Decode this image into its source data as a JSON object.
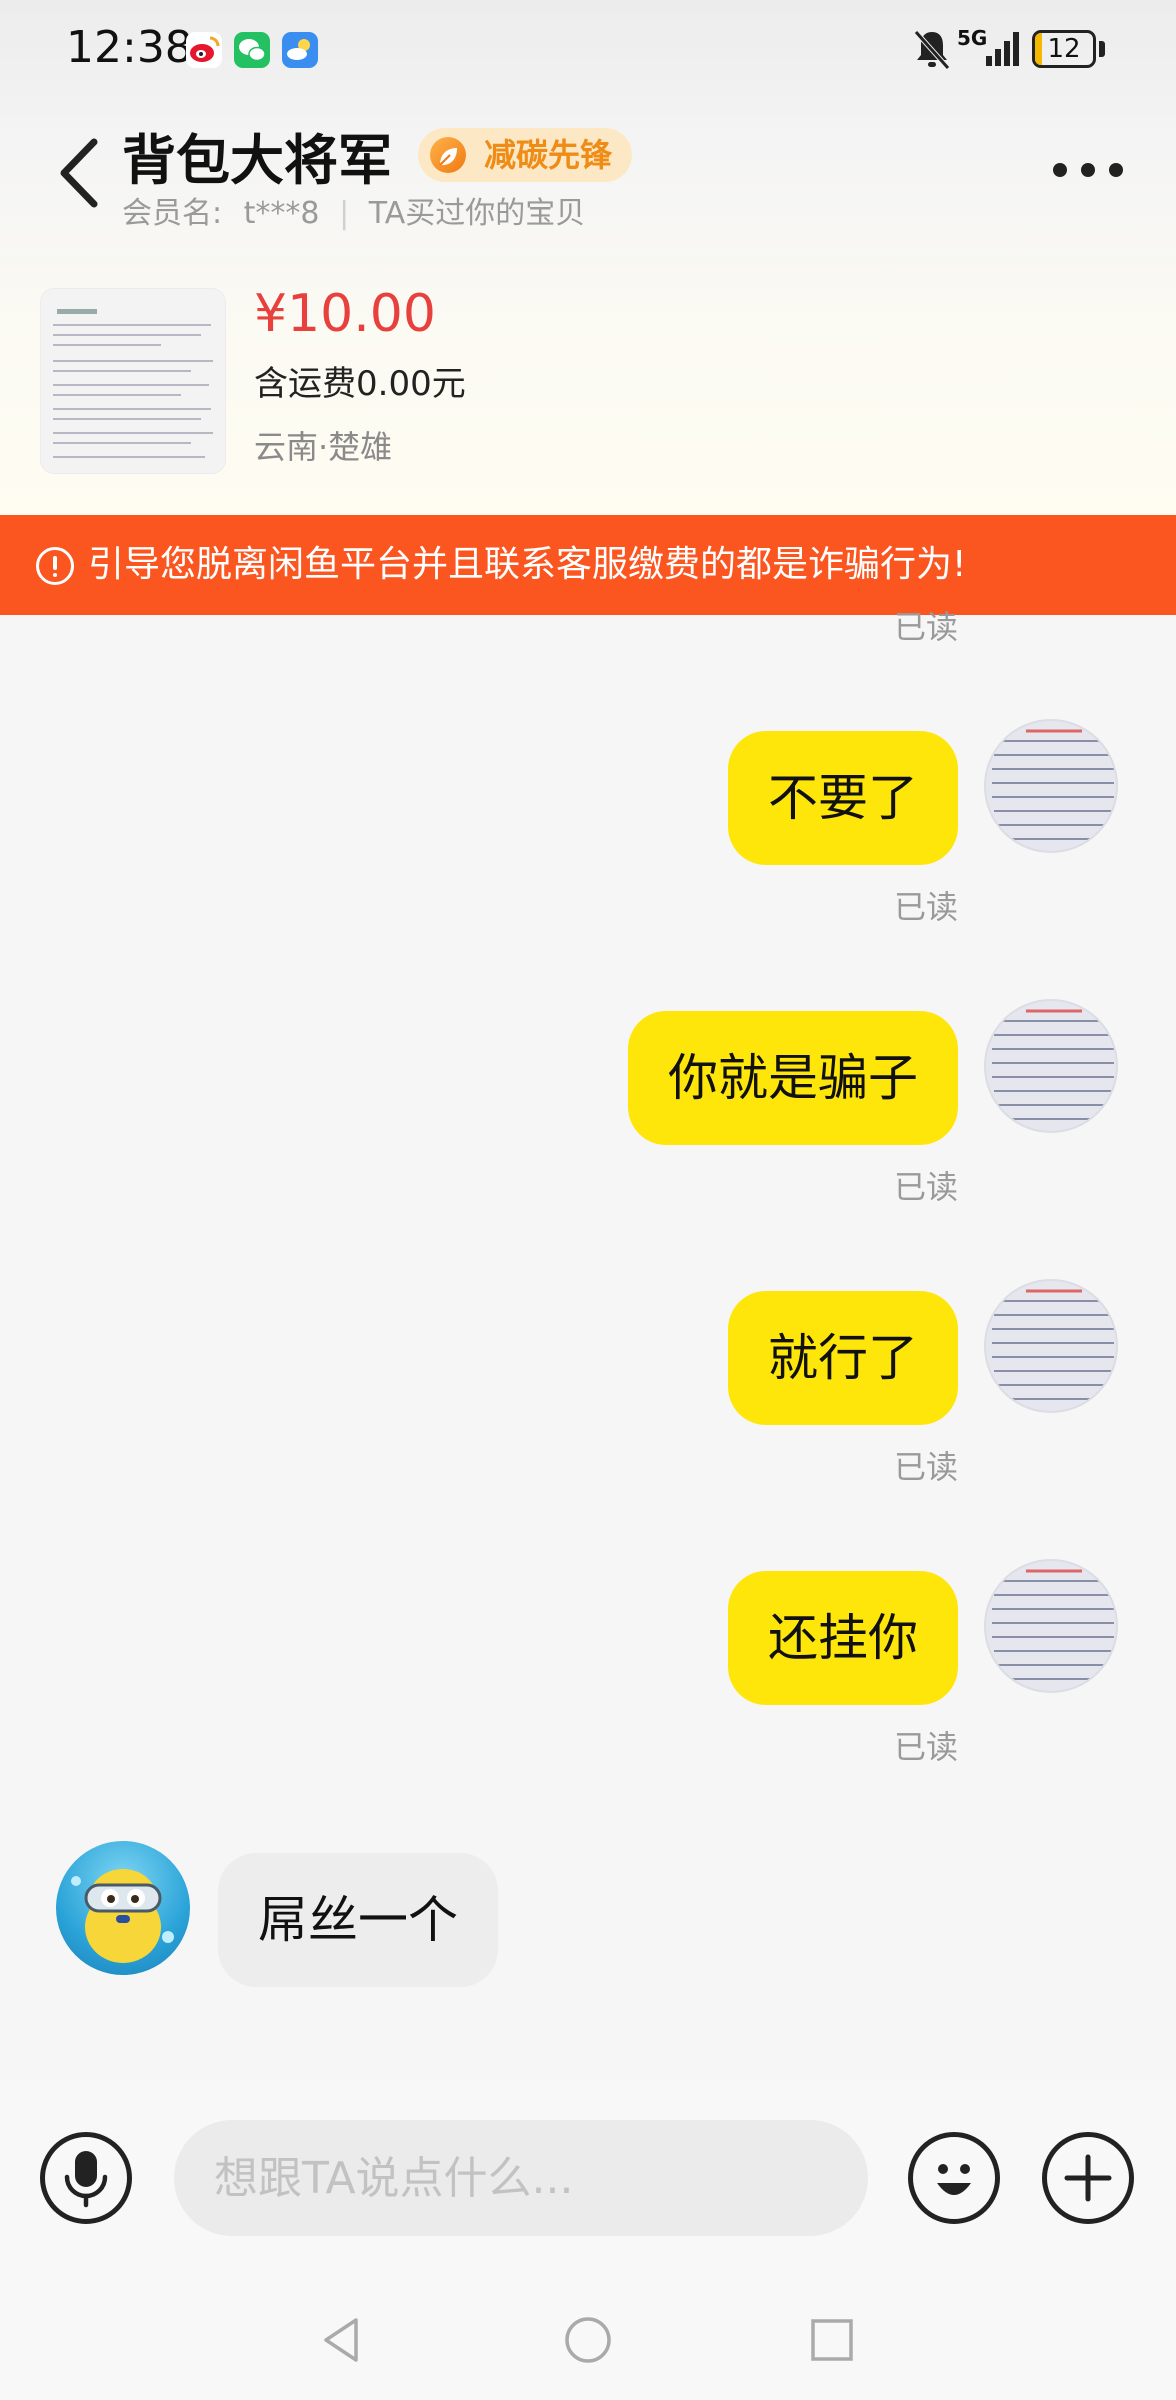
{
  "status_bar": {
    "time": "12:38",
    "icons": [
      "weibo-icon",
      "wechat-icon",
      "weather-icon"
    ],
    "network": "5G",
    "battery": "12",
    "battery_level_percent": 12
  },
  "header": {
    "shop_name": "背包大将军",
    "badge": "减碳先锋",
    "member_label": "会员名:",
    "member_name": "t***8",
    "member_note": "TA买过你的宝贝"
  },
  "product": {
    "price": "¥10.00",
    "shipping": "含运费0.00元",
    "location": "云南·楚雄"
  },
  "warning": {
    "text": "引导您脱离闲鱼平台并且联系客服缴费的都是诈骗行为!"
  },
  "messages": {
    "read_label": "已读",
    "outgoing": [
      {
        "text": "不要了"
      },
      {
        "text": "你就是骗子"
      },
      {
        "text": "就行了"
      },
      {
        "text": "还挂你"
      }
    ],
    "incoming": [
      {
        "text": "屌丝一个"
      }
    ]
  },
  "input_bar": {
    "placeholder": "想跟TA说点什么..."
  },
  "colors": {
    "accent_yellow": "#ffe60a",
    "warning_orange": "#fb5520",
    "price_red": "#e8413d",
    "badge_orange": "#ef8c16"
  }
}
